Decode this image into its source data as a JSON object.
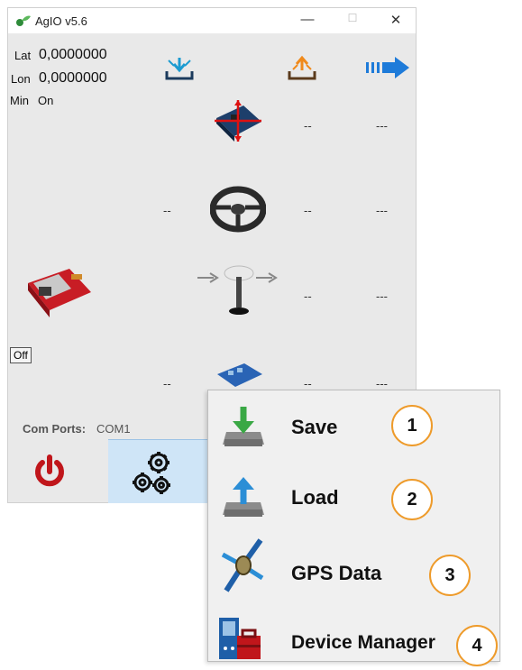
{
  "window": {
    "title": "AgIO v5.6",
    "controls": {
      "minimize": "—",
      "maximize": "☐",
      "close": "✕"
    }
  },
  "gps": {
    "lat_label": "Lat",
    "lat_value": "0,0000000",
    "lon_label": "Lon",
    "lon_value": "0,0000000",
    "min_label": "Min",
    "min_value": "On"
  },
  "rows": [
    {
      "name": "imu",
      "in": "",
      "out1": "--",
      "out2": "---"
    },
    {
      "name": "steer",
      "in": "--",
      "out1": "--",
      "out2": "---"
    },
    {
      "name": "gps",
      "in": "",
      "out1": "--",
      "out2": "---"
    },
    {
      "name": "machine",
      "in": "--",
      "out1": "--",
      "out2": "---"
    }
  ],
  "ethernet": {
    "off_label": "Off"
  },
  "com_ports": {
    "label": "Com Ports:",
    "value": "COM1"
  },
  "menu": {
    "items": [
      {
        "label": "Save",
        "badge": "1",
        "icon": "save-drive-icon"
      },
      {
        "label": "Load",
        "badge": "2",
        "icon": "load-drive-icon"
      },
      {
        "label": "GPS Data",
        "badge": "3",
        "icon": "satellite-icon"
      },
      {
        "label": "Device Manager",
        "badge": "4",
        "icon": "device-manager-icon"
      }
    ]
  },
  "colors": {
    "accent_blue": "#1e7bd9",
    "download_cyan": "#1b9bd1",
    "upload_orange": "#f08a1c",
    "power_red": "#c0161b",
    "badge_orange": "#ee9b2b",
    "save_green": "#3aa845",
    "load_blue": "#2b8ed6"
  }
}
